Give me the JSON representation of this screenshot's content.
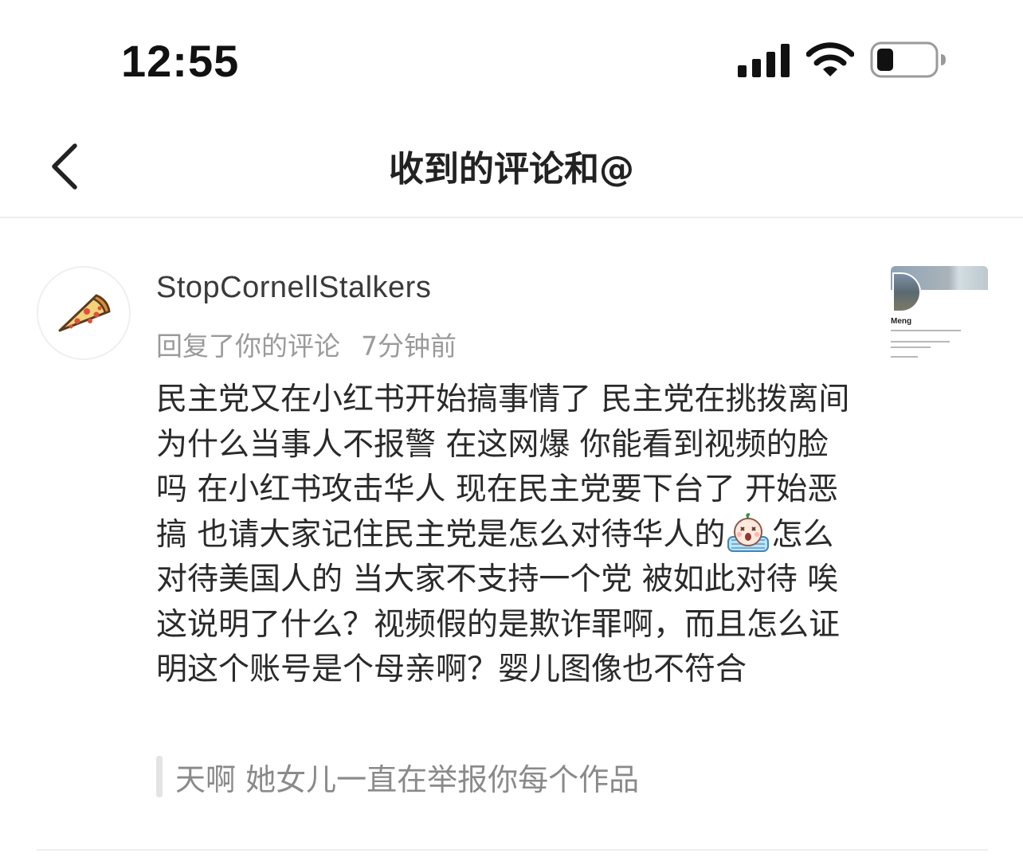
{
  "status_bar": {
    "time": "12:55"
  },
  "nav": {
    "title": "收到的评论和@"
  },
  "comment": {
    "username": "StopCornellStalkers",
    "action": "回复了你的评论",
    "time_ago": "7分钟前",
    "body_before_emoji": "民主党又在小红书开始搞事情了 民主党在挑拨离间 为什么当事人不报警 在这网爆 你能看到视频的脸吗 在小红书攻击华人 现在民主党要下台了 开始恶搞 也请大家记住民主党是怎么对待华人的",
    "body_after_emoji": "怎么对待美国人的 当大家不支持一个党 被如此对待 唉 这说明了什么？视频假的是欺诈罪啊，而且怎么证明这个账号是个母亲啊？婴儿图像也不符合",
    "quoted_text": "天啊 她女儿一直在举报你每个作品",
    "thumbnail_name": "Meng"
  },
  "icons": {
    "back": "chevron-left-icon",
    "avatar": "pizza-icon",
    "emoji": "crying-face-emoji-icon",
    "signal": "cellular-signal-icon",
    "wifi": "wifi-icon",
    "battery": "battery-icon"
  },
  "colors": {
    "text_primary": "#2a2a2a",
    "text_secondary": "#9a9a9a",
    "divider": "#eeeeee"
  }
}
